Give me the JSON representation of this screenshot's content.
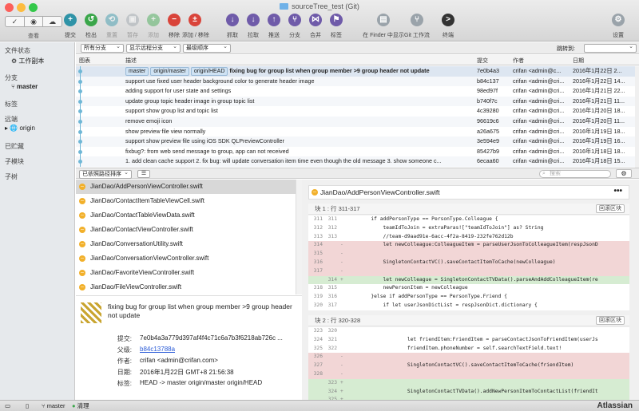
{
  "window": {
    "title": "sourceTree_test (Git)"
  },
  "toolbar": {
    "view_label": "查看",
    "view_options": [
      "✓",
      "◉",
      "☁"
    ],
    "buttons": [
      {
        "label": "提交",
        "icon": "commit-icon",
        "color": "#2f93a7",
        "enabled": true
      },
      {
        "label": "检出",
        "icon": "checkout-icon",
        "color": "#3aa64a",
        "enabled": true
      },
      {
        "label": "重置",
        "icon": "reset-icon",
        "color": "#2f93a7",
        "enabled": false
      },
      {
        "label": "暂存",
        "icon": "stash-icon",
        "color": "#9aa3aa",
        "enabled": false
      },
      {
        "label": "添加",
        "icon": "add-icon",
        "color": "#3aa64a",
        "enabled": false
      },
      {
        "label": "移除",
        "icon": "remove-icon",
        "color": "#d9443a",
        "enabled": true
      },
      {
        "label": "添加 / 移除",
        "icon": "add-remove-icon",
        "color": "#d9443a",
        "enabled": true
      },
      {
        "label": "抓取",
        "icon": "fetch-icon",
        "color": "#6f5ba9",
        "enabled": true
      },
      {
        "label": "拉取",
        "icon": "pull-icon",
        "color": "#6f5ba9",
        "enabled": true
      },
      {
        "label": "推送",
        "icon": "push-icon",
        "color": "#6f5ba9",
        "enabled": true
      },
      {
        "label": "分支",
        "icon": "branch-icon",
        "color": "#6f5ba9",
        "enabled": true
      },
      {
        "label": "合并",
        "icon": "merge-icon",
        "color": "#6f5ba9",
        "enabled": true
      },
      {
        "label": "标签",
        "icon": "tag-icon",
        "color": "#6f5ba9",
        "enabled": true
      },
      {
        "label": "在 Finder 中显示",
        "icon": "finder-icon",
        "color": "#9aa3aa",
        "enabled": true
      },
      {
        "label": "Git 工作流",
        "icon": "git-flow-icon",
        "color": "#9aa3aa",
        "enabled": true
      },
      {
        "label": "终端",
        "icon": "terminal-icon",
        "color": "#333333",
        "enabled": true
      },
      {
        "label": "设置",
        "icon": "settings-icon",
        "color": "#9aa3aa",
        "enabled": true
      }
    ]
  },
  "sidebar": {
    "file_status": "文件状态",
    "working_copy": "工作副本",
    "branches": "分支",
    "master": "master",
    "tags": "标签",
    "remotes": "远端",
    "origin": "origin",
    "stashes": "已贮藏",
    "submodules": "子模块",
    "subtrees": "子树"
  },
  "filters": {
    "branches": "所有分支",
    "remote": "显示远程分支",
    "order": "最级顺序",
    "jump_label": "跳转到:"
  },
  "table": {
    "headers": {
      "graph": "图表",
      "desc": "描述",
      "hash": "提交",
      "author": "作者",
      "date": "日期"
    },
    "commits": [
      {
        "refs": [
          "master",
          "origin/master",
          "origin/HEAD"
        ],
        "desc": "fixing bug for group list when group member >9 group header not update",
        "hash": "7e0b4a3",
        "author": "crifan <admin@c...",
        "date": "2016年1月22日 2..."
      },
      {
        "refs": [],
        "desc": "support use fixed user header background color to generate header image",
        "hash": "b84c137",
        "author": "crifan <admin@cri...",
        "date": "2016年1月22日 14..."
      },
      {
        "refs": [],
        "desc": "adding support for user state and settings",
        "hash": "98ed97f",
        "author": "crifan <admin@cri...",
        "date": "2016年1月21日 22..."
      },
      {
        "refs": [],
        "desc": "update group topic header image in group topic list",
        "hash": "b740f7c",
        "author": "crifan <admin@cri...",
        "date": "2016年1月21日 11..."
      },
      {
        "refs": [],
        "desc": "support show group list and topic list",
        "hash": "4c39280",
        "author": "crifan <admin@cri...",
        "date": "2016年1月20日 18..."
      },
      {
        "refs": [],
        "desc": "remove emoji icon",
        "hash": "96619c6",
        "author": "crifan <admin@cri...",
        "date": "2016年1月20日 11..."
      },
      {
        "refs": [],
        "desc": "show preview file view normally",
        "hash": "a26a675",
        "author": "crifan <admin@cri...",
        "date": "2016年1月19日 18..."
      },
      {
        "refs": [],
        "desc": "support show preview file using iOS SDK QLPreviewController",
        "hash": "3e594e9",
        "author": "crifan <admin@cri...",
        "date": "2016年1月19日 16..."
      },
      {
        "refs": [],
        "desc": "fixbug?: from web send message to group, app can not received",
        "hash": "85427b9",
        "author": "crifan <admin@cri...",
        "date": "2016年1月18日 18..."
      },
      {
        "refs": [],
        "desc": "1. add clean cache support 2. fix bug: will update conversation item time even though the old message 3. show someone c...",
        "hash": "6ecaa60",
        "author": "crifan <admin@cri...",
        "date": "2016年1月18日 15..."
      }
    ]
  },
  "midbar": {
    "sort": "已依照路径排序",
    "search_placeholder": "搜索"
  },
  "files": [
    "JianDao/AddPersonViewController.swift",
    "JianDao/ContactItemTableViewCell.swift",
    "JianDao/ContactTableViewData.swift",
    "JianDao/ContactViewController.swift",
    "JianDao/ConversationUtility.swift",
    "JianDao/ConversationViewController.swift",
    "JianDao/FavoriteViewController.swift",
    "JianDao/FileViewController.swift"
  ],
  "detail": {
    "message": "fixing bug for group list when group member >9 group header not update",
    "commit_label": "提交:",
    "commit": "7e0b4a3a779d397af4f4c71c6a7b3f6218ab726c ...",
    "parent_label": "父级:",
    "parent": "b84c13788a",
    "author_label": "作者:",
    "author": "crifan <admin@crifan.com>",
    "date_label": "日期:",
    "date": "2016年1月22日 GMT+8 21:56:38",
    "labels_label": "标签:",
    "labels": "HEAD -> master origin/master origin/HEAD"
  },
  "diff": {
    "file": "JianDao/AddPersonViewController.swift",
    "more": "•••",
    "discard": "回滚区块",
    "hunk1": "块 1 : 行 311-317",
    "hunk2": "块 2 : 行 320-328",
    "lines1": [
      {
        "a": "311",
        "b": "311",
        "t": "ctx",
        "c": "        if addPersonType == PersonType.Colleague {"
      },
      {
        "a": "312",
        "b": "312",
        "t": "ctx",
        "c": "            teamIdToJoin = extraParas![\"teamIdToJoin\"] as? String"
      },
      {
        "a": "313",
        "b": "313",
        "t": "ctx",
        "c": "            //team-d9aad91e-6acc-4f2a-8419-232fe762d12b"
      },
      {
        "a": "314",
        "b": "",
        "t": "del",
        "c": "            let newColleague:ColleagueItem = parseUserJsonToColleagueItem(respJsonD"
      },
      {
        "a": "315",
        "b": "",
        "t": "del",
        "c": ""
      },
      {
        "a": "316",
        "b": "",
        "t": "del",
        "c": "            SingletonContactVC().saveContactItemToCache(newColleague)"
      },
      {
        "a": "317",
        "b": "",
        "t": "del",
        "c": ""
      },
      {
        "a": "",
        "b": "314",
        "t": "add",
        "c": "            let newColleague = SingletonContactTVData().parseAndAddColleagueItem(re"
      },
      {
        "a": "318",
        "b": "315",
        "t": "ctx",
        "c": "            newPersonItem = newColleague"
      },
      {
        "a": "319",
        "b": "316",
        "t": "ctx",
        "c": "        }else if addPersonType == PersonType.Friend {"
      },
      {
        "a": "320",
        "b": "317",
        "t": "ctx",
        "c": "            if let userJsonDictList = respJsonDict.dictionary {"
      }
    ],
    "lines2": [
      {
        "a": "323",
        "b": "320",
        "t": "ctx",
        "c": ""
      },
      {
        "a": "324",
        "b": "321",
        "t": "ctx",
        "c": "                    let friendItem:FriendItem = parseContactJsonToFriendItem(userJs"
      },
      {
        "a": "325",
        "b": "322",
        "t": "ctx",
        "c": "                    friendItem.phoneNumber = self.searchTextField.text!"
      },
      {
        "a": "326",
        "b": "",
        "t": "del",
        "c": ""
      },
      {
        "a": "327",
        "b": "",
        "t": "del",
        "c": "                    SingletonContactVC().saveContactItemToCache(friendItem)"
      },
      {
        "a": "328",
        "b": "",
        "t": "del",
        "c": ""
      },
      {
        "a": "",
        "b": "323",
        "t": "add",
        "c": ""
      },
      {
        "a": "",
        "b": "324",
        "t": "add",
        "c": "                    SingletonContactTVData().addNewPersonItemToContactList(friendIt"
      },
      {
        "a": "",
        "b": "325",
        "t": "add",
        "c": ""
      }
    ]
  },
  "status": {
    "branch": "master",
    "clean": "清理",
    "brand": "Atlassian"
  }
}
